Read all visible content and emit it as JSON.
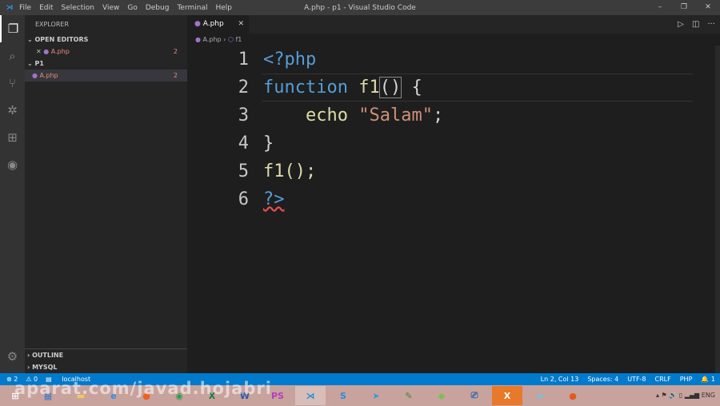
{
  "window": {
    "title": "A.php - p1 - Visual Studio Code",
    "menu": [
      "File",
      "Edit",
      "Selection",
      "View",
      "Go",
      "Debug",
      "Terminal",
      "Help"
    ]
  },
  "sidebar": {
    "header": "EXPLORER",
    "open_editors": "OPEN EDITORS",
    "open_file": "A.php",
    "open_file_badge": "2",
    "folder": "P1",
    "folder_file": "A.php",
    "folder_file_badge": "2",
    "outline": "OUTLINE",
    "mysql": "MYSQL"
  },
  "editor": {
    "tab": "A.php",
    "breadcrumb": [
      "A.php",
      "f1"
    ],
    "lines": [
      "1",
      "2",
      "3",
      "4",
      "5",
      "6"
    ],
    "code": {
      "l1": "<?php",
      "l2a": "function",
      "l2b": " f1",
      "l2c": "()",
      "l2d": " {",
      "l3a": "    echo ",
      "l3b": "\"Salam\"",
      "l3c": ";",
      "l4": "}",
      "l5": "f1();",
      "l6": "?>"
    }
  },
  "status": {
    "errors": "⊗ 2",
    "warnings": "⚠ 0",
    "server": "localhost",
    "position": "Ln 2, Col 13",
    "spaces": "Spaces: 4",
    "encoding": "UTF-8",
    "eol": "CRLF",
    "language": "PHP",
    "notifications": "🔔 1"
  },
  "taskbar": {
    "apps": [
      "windows-start",
      "control-panel",
      "file-explorer",
      "internet-explorer",
      "firefox",
      "chrome",
      "excel",
      "word",
      "phpstorm",
      "vscode",
      "skype",
      "telegram",
      "android-studio",
      "network",
      "xampp",
      "notepad",
      "orange-app"
    ],
    "tray_lang": "ENG"
  },
  "watermark": "aparat.com/javad.hojabri"
}
